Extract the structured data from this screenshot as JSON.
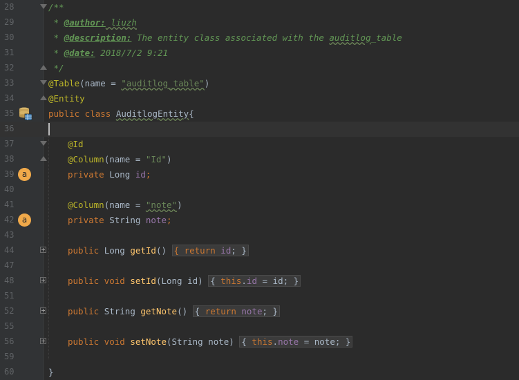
{
  "editor": {
    "lines": [
      {
        "num": "28",
        "html_parts": [
          "/**"
        ]
      },
      {
        "num": "29"
      },
      {
        "num": "30"
      },
      {
        "num": "31"
      },
      {
        "num": "32"
      },
      {
        "num": "33"
      },
      {
        "num": "34"
      },
      {
        "num": "35"
      },
      {
        "num": "36"
      },
      {
        "num": "37"
      },
      {
        "num": "38"
      },
      {
        "num": "39"
      },
      {
        "num": "40"
      },
      {
        "num": "41"
      },
      {
        "num": "42"
      },
      {
        "num": "43"
      },
      {
        "num": "44"
      },
      {
        "num": "47"
      },
      {
        "num": "48"
      },
      {
        "num": "51"
      },
      {
        "num": "52"
      },
      {
        "num": "55"
      },
      {
        "num": "56"
      },
      {
        "num": "59"
      },
      {
        "num": "60"
      }
    ]
  },
  "code": {
    "c28": "/**",
    "c29_star": " * ",
    "c29_tag": "@author:",
    "c29_val": " liuzh",
    "c30_star": " * ",
    "c30_tag": "@description:",
    "c30_val_a": " The entity class associated with the ",
    "c30_val_b": "auditlog",
    "c30_val_c": "_table",
    "c31_star": " * ",
    "c31_tag": "@date:",
    "c31_val": " 2018/7/2 9:21",
    "c32": " */",
    "c33_ann": "@Table",
    "c33_a": "(name = ",
    "c33_str": "\"auditlog_table\"",
    "c33_b": ")",
    "c34_ann": "@Entity",
    "c35_kw": "public class ",
    "c35_name": "AuditlogEntity",
    "c35_b": "{",
    "c37_ann": "@Id",
    "c38_ann": "@Column",
    "c38_a": "(name = ",
    "c38_str": "\"Id\"",
    "c38_b": ")",
    "c39_kw": "private ",
    "c39_type": "Long ",
    "c39_field": "id",
    "c39_semi": ";",
    "c41_ann": "@Column",
    "c41_a": "(name = ",
    "c41_str": "\"note\"",
    "c41_b": ")",
    "c42_kw": "private ",
    "c42_type": "String ",
    "c42_field": "note",
    "c42_semi": ";",
    "c44_kw": "public ",
    "c44_type": "Long ",
    "c44_method": "getId",
    "c44_paren": "() ",
    "c44_fold_a": "{ ",
    "c44_ret": "return ",
    "c44_field": "id",
    "c44_fold_b": "; }",
    "c48_kw": "public void ",
    "c48_method": "setId",
    "c48_params": "(Long id) ",
    "c48_fold_a": "{ ",
    "c48_this": "this",
    "c48_dot": ".",
    "c48_field": "id",
    "c48_assign": " = id",
    "c48_fold_b": "; }",
    "c52_kw": "public ",
    "c52_type": "String ",
    "c52_method": "getNote",
    "c52_paren": "() ",
    "c52_fold_a": "{ ",
    "c52_ret": "return ",
    "c52_field": "note",
    "c52_fold_b": "; }",
    "c56_kw": "public void ",
    "c56_method": "setNote",
    "c56_params": "(String note) ",
    "c56_fold_a": "{ ",
    "c56_this": "this",
    "c56_dot": ".",
    "c56_field": "note",
    "c56_assign": " = note",
    "c56_fold_b": "; }",
    "c60": "}"
  },
  "gutter": {
    "badge_39": "a",
    "badge_42": "a"
  },
  "colors": {
    "background": "#2b2b2b",
    "keyword": "#cc7832",
    "string": "#6a8759",
    "annotation": "#bbb529",
    "doc_comment": "#629755",
    "field": "#9876aa",
    "method": "#ffc66d",
    "badge": "#f0a94a"
  }
}
